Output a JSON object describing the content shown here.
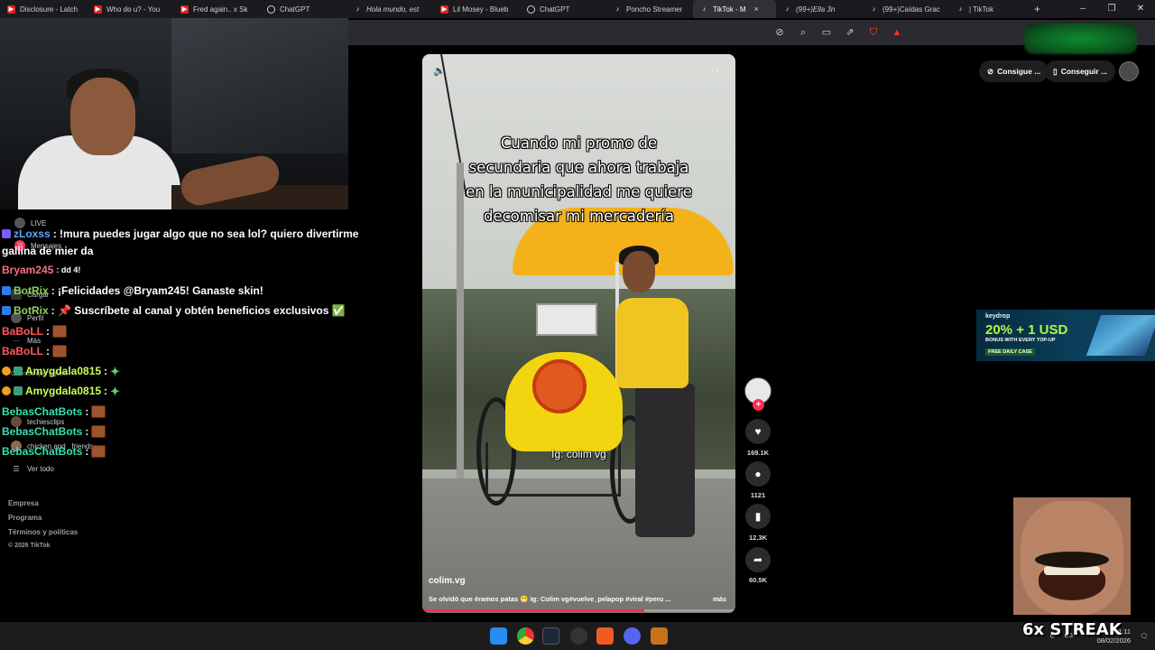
{
  "browser": {
    "tabs": [
      {
        "label": "Disclosure - Latch",
        "icon": "youtube-icon"
      },
      {
        "label": "Who do u? - You",
        "icon": "youtube-icon"
      },
      {
        "label": "Fred again.. x Sk",
        "icon": "youtube-icon"
      },
      {
        "label": "ChatGPT",
        "icon": "chatgpt-icon"
      },
      {
        "label": "Hola mundo, est",
        "icon": "tiktok-icon"
      },
      {
        "label": "Lil Mosey - Blueb",
        "icon": "youtube-icon"
      },
      {
        "label": "ChatGPT",
        "icon": "chatgpt-icon"
      },
      {
        "label": "Poncho Streamer",
        "icon": "tiktok-icon"
      },
      {
        "label": "TikTok - M",
        "icon": "tiktok-icon",
        "active": true
      },
      {
        "label": "(99+)Ella 3n",
        "icon": "tiktok-icon"
      },
      {
        "label": "(99+)Caídas Grac",
        "icon": "tiktok-icon"
      },
      {
        "label": "| TikTok",
        "icon": "tiktok-icon"
      }
    ],
    "new_tab": "+",
    "close_tab": "×"
  },
  "sidebar": {
    "items": [
      {
        "label": "LIVE"
      },
      {
        "label": "Mensajes",
        "badge": "38"
      },
      {
        "label": "Cargar"
      },
      {
        "label": "Perfil"
      },
      {
        "label": "Más"
      },
      {
        "label": "Cuentas que sigues"
      },
      {
        "label": "techiesclips"
      },
      {
        "label": "chicken and _friends"
      },
      {
        "label": "Ver todo"
      }
    ],
    "footer": [
      "Empresa",
      "Programa",
      "Términos y políticas",
      "© 2026 TikTok"
    ]
  },
  "chat": [
    {
      "user": "zLoxss",
      "color": "#5aa9ff",
      "text": ": !mura puedes jugar algo que no sea lol? quiero divertirme"
    },
    {
      "user": "",
      "color": "#ffffff",
      "text": "gallina de mier da"
    },
    {
      "user": "Bryam245",
      "color": "#ff6b8a",
      "text": ": dd 4!"
    },
    {
      "user": "BotRix",
      "color": "#8bd35b",
      "text": ": ¡Felicidades @Bryam245! Ganaste skin!"
    },
    {
      "user": "BotRix",
      "color": "#8bd35b",
      "text": ": 📌 Suscríbete al canal y obtén beneficios exclusivos ✅"
    },
    {
      "user": "BaBoLL",
      "color": "#ff5a5a",
      "text": ":"
    },
    {
      "user": "BaBoLL",
      "color": "#ff5a5a",
      "text": ":"
    },
    {
      "user": "Amygdala0815",
      "color": "#c9ff5a",
      "text": ":"
    },
    {
      "user": "Amygdala0815",
      "color": "#c9ff5a",
      "text": ":"
    },
    {
      "user": "BebasChatBots",
      "color": "#33e0b0",
      "text": ":"
    },
    {
      "user": "BebasChatBots",
      "color": "#33e0b0",
      "text": ":"
    },
    {
      "user": "BebasChatBots",
      "color": "#33e0b0",
      "text": ":"
    }
  ],
  "video": {
    "caption_lines": [
      "Cuando mi promo de",
      "secundaria que ahora trabaja",
      "en la municipalidad me quiere",
      "decomisar mi mercadería"
    ],
    "overlay_text": "Ig: colim vg",
    "author": "colim.vg",
    "description": "Se olvidó que éramos patas 😁 Ig: Colim vg#vuelve_pelapop #viral #peru ...",
    "more": "más",
    "progress": 0.71
  },
  "actions": {
    "likes": "169.1K",
    "comments": "1121",
    "saves": "12.3K",
    "shares": "60.5K"
  },
  "header_pills": {
    "coins": "Consigue ...",
    "app": "Conseguir ..."
  },
  "ad": {
    "brand": "keydrop",
    "headline": "20% + 1 USD",
    "sub": "BONUS WITH EVERY TOP-UP",
    "tag": "FREE DAILY CASE"
  },
  "overlay": {
    "streak": "6x STREAK"
  },
  "taskbar": {
    "lang": "ES",
    "time": "1:11",
    "date": "08/02/2026"
  }
}
